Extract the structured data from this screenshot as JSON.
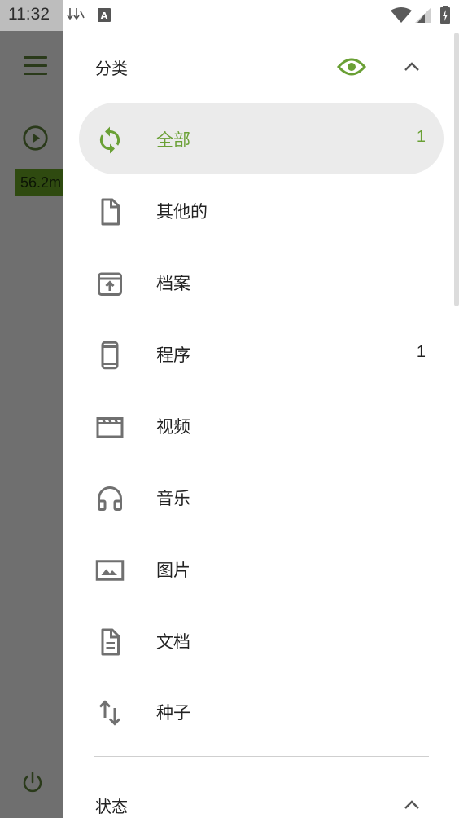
{
  "status_bar": {
    "time": "11:32"
  },
  "background_app": {
    "speed": "56.2m"
  },
  "drawer": {
    "categories": {
      "title": "分类",
      "items": [
        {
          "label": "全部",
          "count": "1",
          "icon": "refresh-icon",
          "selected": true
        },
        {
          "label": "其他的",
          "count": "",
          "icon": "file-icon"
        },
        {
          "label": "档案",
          "count": "",
          "icon": "archive-icon"
        },
        {
          "label": "程序",
          "count": "1",
          "icon": "phone-icon"
        },
        {
          "label": "视频",
          "count": "",
          "icon": "video-icon"
        },
        {
          "label": "音乐",
          "count": "",
          "icon": "headphones-icon"
        },
        {
          "label": "图片",
          "count": "",
          "icon": "image-icon"
        },
        {
          "label": "文档",
          "count": "",
          "icon": "document-icon"
        },
        {
          "label": "种子",
          "count": "",
          "icon": "swap-vertical-icon"
        }
      ]
    },
    "status": {
      "title": "状态"
    }
  },
  "colors": {
    "accent": "#6aa035",
    "icon_gray": "#707070",
    "selected_bg": "#ebebeb"
  }
}
